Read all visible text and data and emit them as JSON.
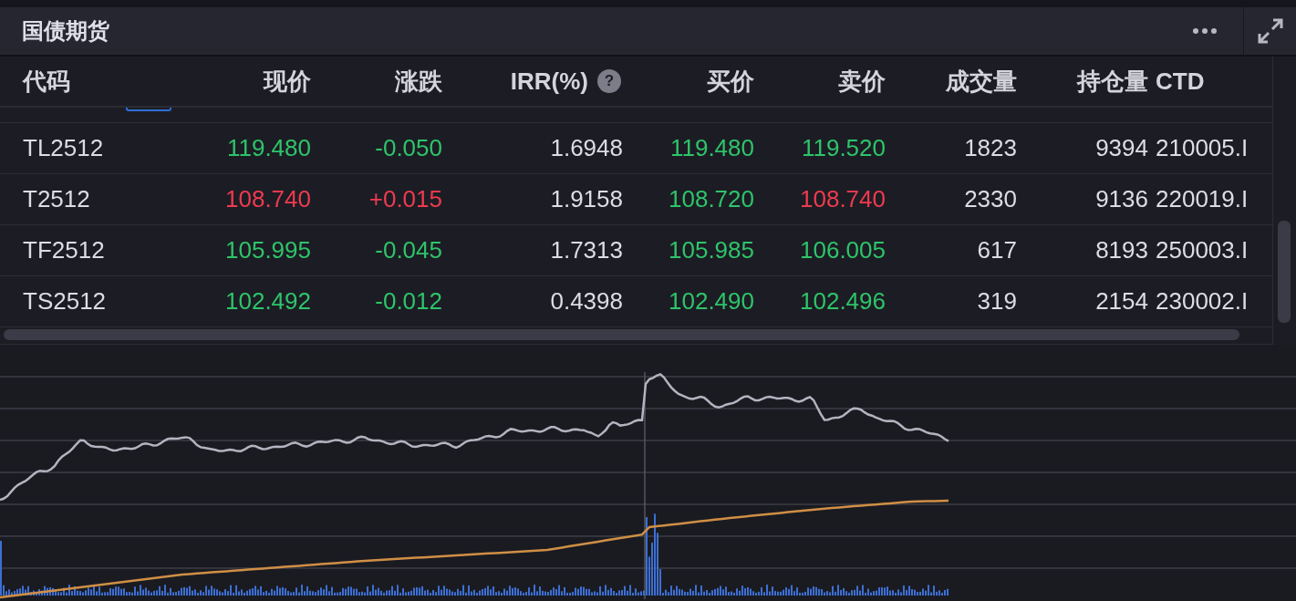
{
  "panel": {
    "title": "国债期货"
  },
  "table": {
    "columns": [
      {
        "label": "代码"
      },
      {
        "label": "现价"
      },
      {
        "label": "涨跌"
      },
      {
        "label": "IRR(%)",
        "help": "?"
      },
      {
        "label": "买价"
      },
      {
        "label": "卖价"
      },
      {
        "label": "成交量"
      },
      {
        "label": "持仓量"
      },
      {
        "label": "CTD"
      }
    ],
    "rows": [
      {
        "cells": [
          {
            "text": "TL2512"
          },
          {
            "text": "119.480",
            "up": false
          },
          {
            "text": "-0.050",
            "up": false
          },
          {
            "text": "1.6948"
          },
          {
            "text": "119.480",
            "up": false
          },
          {
            "text": "119.520",
            "up": false
          },
          {
            "text": "1823"
          },
          {
            "text": "9394"
          },
          {
            "text": "210005.I"
          }
        ]
      },
      {
        "cells": [
          {
            "text": "T2512"
          },
          {
            "text": "108.740",
            "up": true
          },
          {
            "text": "+0.015",
            "up": true
          },
          {
            "text": "1.9158"
          },
          {
            "text": "108.720",
            "up": false
          },
          {
            "text": "108.740",
            "up": true
          },
          {
            "text": "2330"
          },
          {
            "text": "9136"
          },
          {
            "text": "220019.I"
          }
        ]
      },
      {
        "cells": [
          {
            "text": "TF2512"
          },
          {
            "text": "105.995",
            "up": false
          },
          {
            "text": "-0.045",
            "up": false
          },
          {
            "text": "1.7313"
          },
          {
            "text": "105.985",
            "up": false
          },
          {
            "text": "106.005",
            "up": false
          },
          {
            "text": "617"
          },
          {
            "text": "8193"
          },
          {
            "text": "250003.I"
          }
        ]
      },
      {
        "cells": [
          {
            "text": "TS2512"
          },
          {
            "text": "102.492",
            "up": false
          },
          {
            "text": "-0.012",
            "up": false
          },
          {
            "text": "0.4398"
          },
          {
            "text": "102.490",
            "up": false
          },
          {
            "text": "102.496",
            "up": false
          },
          {
            "text": "319"
          },
          {
            "text": "2154"
          },
          {
            "text": "230002.I"
          }
        ]
      }
    ]
  }
}
